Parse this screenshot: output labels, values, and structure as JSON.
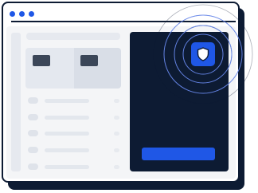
{
  "colors": {
    "navy": "#0d1b33",
    "accent_blue": "#1f57e6",
    "placeholder_gray": "#e3e7ed",
    "content_background": "#f4f5f7"
  },
  "window": {
    "controls": [
      "window-dot",
      "window-dot",
      "window-dot"
    ]
  },
  "security_badge": {
    "icon": "shield-icon"
  },
  "list_rows": 5
}
